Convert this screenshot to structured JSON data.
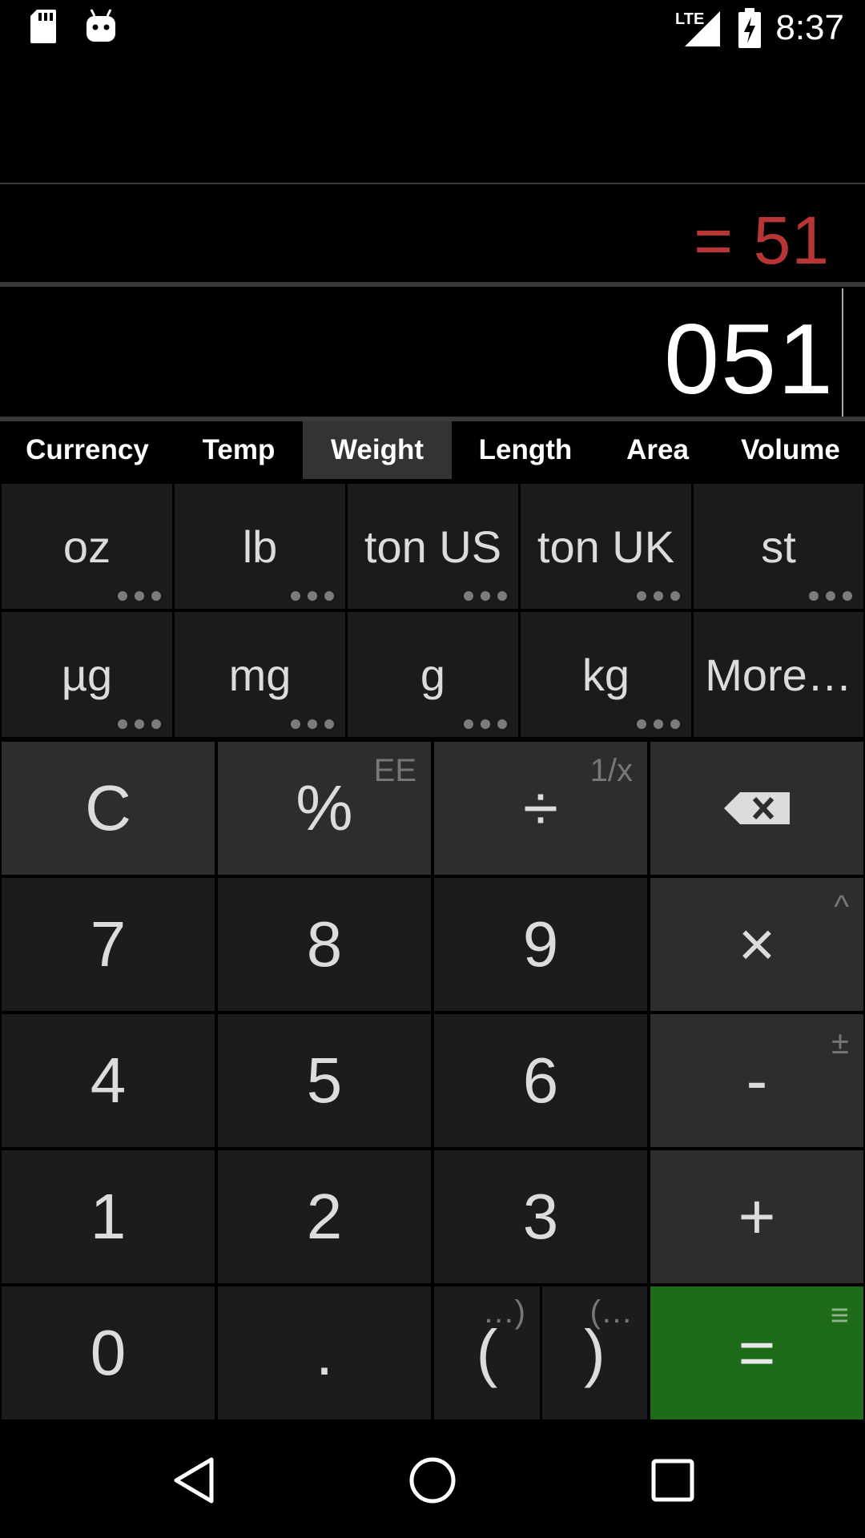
{
  "status_bar": {
    "left_icons": [
      "sd-card-icon",
      "android-icon"
    ],
    "right_icons": [
      "lte-signal-icon",
      "battery-charging-icon"
    ],
    "network": "LTE",
    "time": "8:37"
  },
  "display": {
    "result": "= 51",
    "expression": "051",
    "result_color": "#b73535"
  },
  "tabs": [
    {
      "label": "Currency",
      "active": false
    },
    {
      "label": "Temp",
      "active": false
    },
    {
      "label": "Weight",
      "active": true
    },
    {
      "label": "Length",
      "active": false
    },
    {
      "label": "Area",
      "active": false
    },
    {
      "label": "Volume",
      "active": false
    }
  ],
  "units": {
    "row1": [
      "oz",
      "lb",
      "ton US",
      "ton UK",
      "st"
    ],
    "row2": [
      "µg",
      "mg",
      "g",
      "kg",
      "More…"
    ]
  },
  "keys": {
    "clear": "C",
    "percent": "%",
    "percent_alt": "EE",
    "divide": "÷",
    "divide_alt": "1/x",
    "backspace_icon": "backspace-icon",
    "seven": "7",
    "eight": "8",
    "nine": "9",
    "multiply": "×",
    "multiply_alt": "^",
    "four": "4",
    "five": "5",
    "six": "6",
    "minus": "-",
    "minus_alt": "±",
    "one": "1",
    "two": "2",
    "three": "3",
    "plus": "+",
    "zero": "0",
    "decimal": ".",
    "open_paren": "(",
    "open_paren_alt": "…)",
    "close_paren": ")",
    "close_paren_alt": "(…",
    "equals": "=",
    "equals_alt": "≡",
    "equals_color": "#1e6b1a"
  },
  "nav_bar": {
    "icons": [
      "back-icon",
      "home-icon",
      "recents-icon"
    ]
  }
}
